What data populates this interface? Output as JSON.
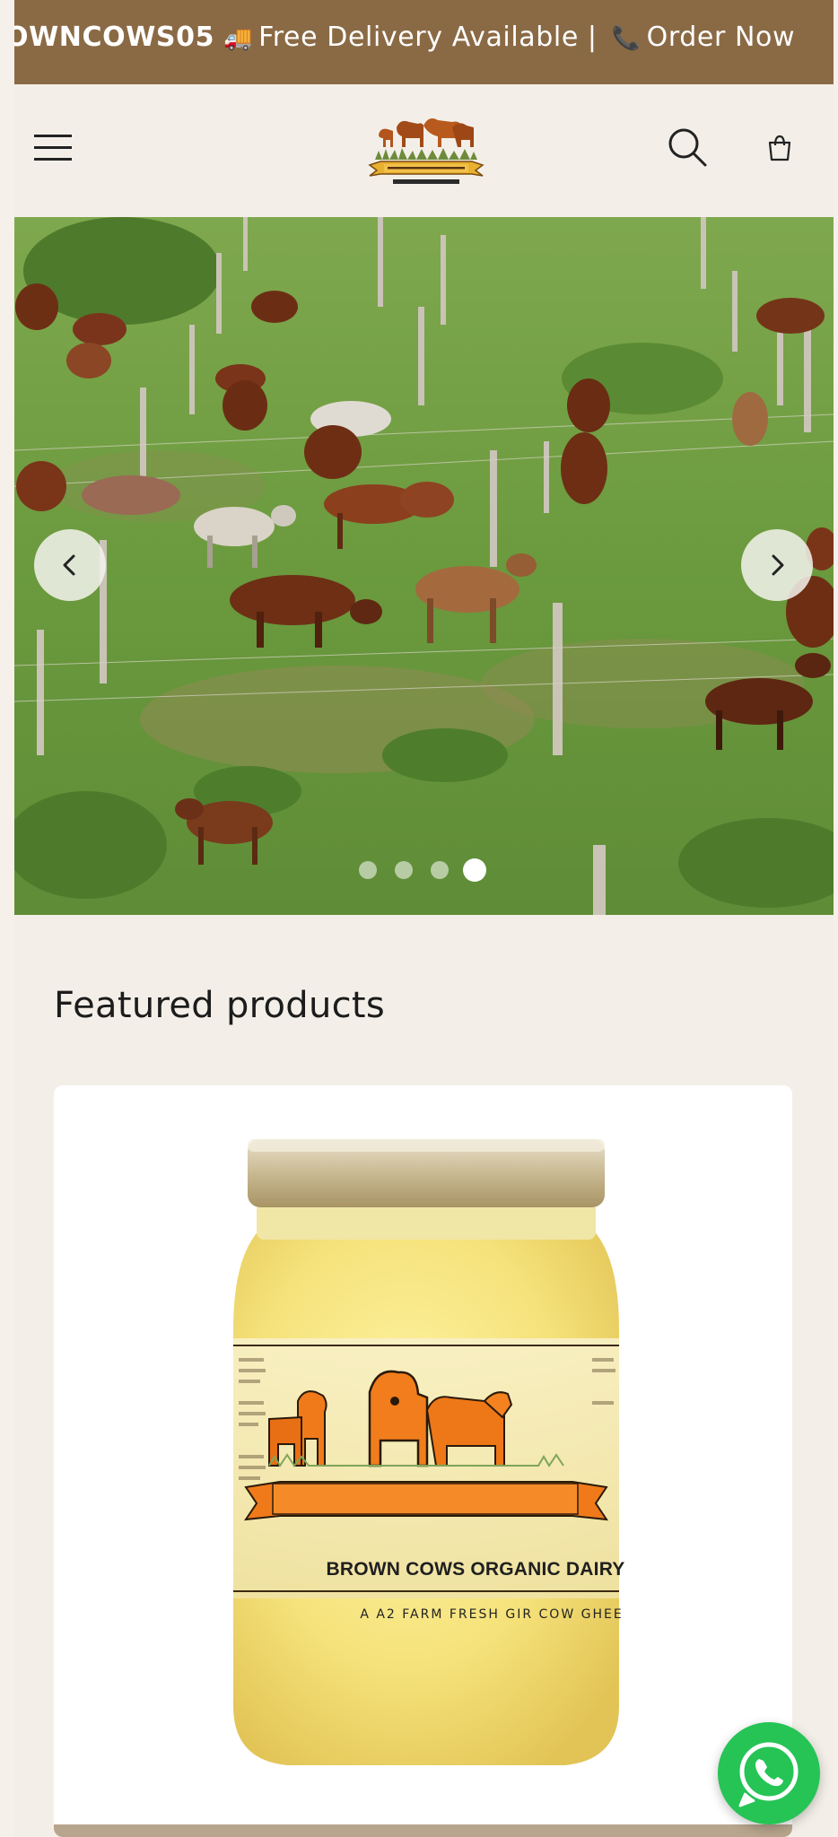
{
  "announcement": {
    "code": "OWNCOWS05",
    "delivery": "Free Delivery Available",
    "separator": "|",
    "order": "Order Now",
    "icons": [
      "truck-icon",
      "phone-icon"
    ]
  },
  "header": {
    "menu_icon": "hamburger-icon",
    "logo_alt": "Brown Cows Organic Dairy logo",
    "search_icon": "search-icon",
    "cart_icon": "cart-bag-icon"
  },
  "hero": {
    "slide_count": 4,
    "active_slide": 4,
    "prev_icon": "chevron-left-icon",
    "next_icon": "chevron-right-icon"
  },
  "featured": {
    "title": "Featured products",
    "product": {
      "label_title": "BROWN COWS ORGANIC DAIRY",
      "label_subtitle": "A A2 FARM FRESH GIR COW GHEE"
    }
  },
  "whatsapp": {
    "icon": "whatsapp-icon"
  },
  "colors": {
    "announcement_bg": "#8a6a45",
    "page_bg": "#f3efe8",
    "whatsapp_green": "#25c455",
    "label_orange": "#f07a1a"
  }
}
